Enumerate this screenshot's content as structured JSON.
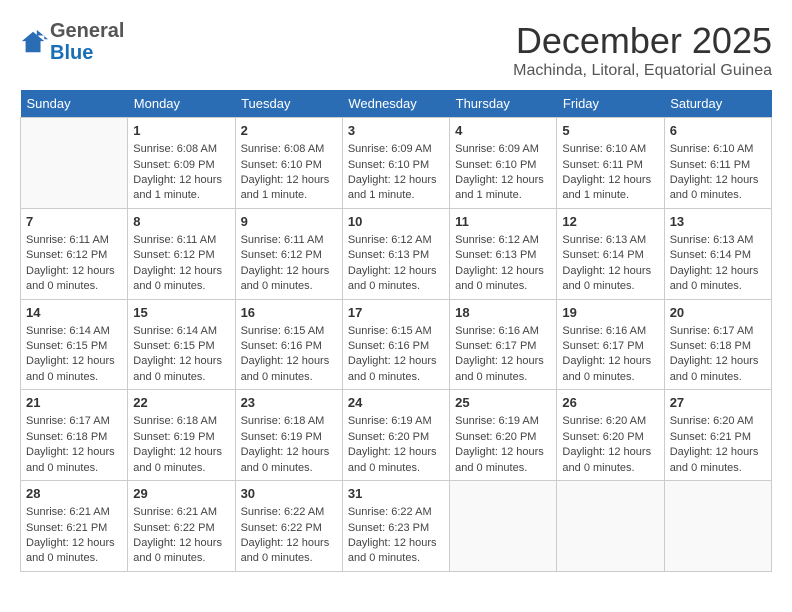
{
  "header": {
    "logo_line1": "General",
    "logo_line2": "Blue",
    "month_year": "December 2025",
    "location": "Machinda, Litoral, Equatorial Guinea"
  },
  "days_of_week": [
    "Sunday",
    "Monday",
    "Tuesday",
    "Wednesday",
    "Thursday",
    "Friday",
    "Saturday"
  ],
  "weeks": [
    [
      {
        "day": "",
        "content": ""
      },
      {
        "day": "1",
        "content": "Sunrise: 6:08 AM\nSunset: 6:09 PM\nDaylight: 12 hours and 1 minute."
      },
      {
        "day": "2",
        "content": "Sunrise: 6:08 AM\nSunset: 6:10 PM\nDaylight: 12 hours and 1 minute."
      },
      {
        "day": "3",
        "content": "Sunrise: 6:09 AM\nSunset: 6:10 PM\nDaylight: 12 hours and 1 minute."
      },
      {
        "day": "4",
        "content": "Sunrise: 6:09 AM\nSunset: 6:10 PM\nDaylight: 12 hours and 1 minute."
      },
      {
        "day": "5",
        "content": "Sunrise: 6:10 AM\nSunset: 6:11 PM\nDaylight: 12 hours and 1 minute."
      },
      {
        "day": "6",
        "content": "Sunrise: 6:10 AM\nSunset: 6:11 PM\nDaylight: 12 hours and 0 minutes."
      }
    ],
    [
      {
        "day": "7",
        "content": "Sunrise: 6:11 AM\nSunset: 6:12 PM\nDaylight: 12 hours and 0 minutes."
      },
      {
        "day": "8",
        "content": "Sunrise: 6:11 AM\nSunset: 6:12 PM\nDaylight: 12 hours and 0 minutes."
      },
      {
        "day": "9",
        "content": "Sunrise: 6:11 AM\nSunset: 6:12 PM\nDaylight: 12 hours and 0 minutes."
      },
      {
        "day": "10",
        "content": "Sunrise: 6:12 AM\nSunset: 6:13 PM\nDaylight: 12 hours and 0 minutes."
      },
      {
        "day": "11",
        "content": "Sunrise: 6:12 AM\nSunset: 6:13 PM\nDaylight: 12 hours and 0 minutes."
      },
      {
        "day": "12",
        "content": "Sunrise: 6:13 AM\nSunset: 6:14 PM\nDaylight: 12 hours and 0 minutes."
      },
      {
        "day": "13",
        "content": "Sunrise: 6:13 AM\nSunset: 6:14 PM\nDaylight: 12 hours and 0 minutes."
      }
    ],
    [
      {
        "day": "14",
        "content": "Sunrise: 6:14 AM\nSunset: 6:15 PM\nDaylight: 12 hours and 0 minutes."
      },
      {
        "day": "15",
        "content": "Sunrise: 6:14 AM\nSunset: 6:15 PM\nDaylight: 12 hours and 0 minutes."
      },
      {
        "day": "16",
        "content": "Sunrise: 6:15 AM\nSunset: 6:16 PM\nDaylight: 12 hours and 0 minutes."
      },
      {
        "day": "17",
        "content": "Sunrise: 6:15 AM\nSunset: 6:16 PM\nDaylight: 12 hours and 0 minutes."
      },
      {
        "day": "18",
        "content": "Sunrise: 6:16 AM\nSunset: 6:17 PM\nDaylight: 12 hours and 0 minutes."
      },
      {
        "day": "19",
        "content": "Sunrise: 6:16 AM\nSunset: 6:17 PM\nDaylight: 12 hours and 0 minutes."
      },
      {
        "day": "20",
        "content": "Sunrise: 6:17 AM\nSunset: 6:18 PM\nDaylight: 12 hours and 0 minutes."
      }
    ],
    [
      {
        "day": "21",
        "content": "Sunrise: 6:17 AM\nSunset: 6:18 PM\nDaylight: 12 hours and 0 minutes."
      },
      {
        "day": "22",
        "content": "Sunrise: 6:18 AM\nSunset: 6:19 PM\nDaylight: 12 hours and 0 minutes."
      },
      {
        "day": "23",
        "content": "Sunrise: 6:18 AM\nSunset: 6:19 PM\nDaylight: 12 hours and 0 minutes."
      },
      {
        "day": "24",
        "content": "Sunrise: 6:19 AM\nSunset: 6:20 PM\nDaylight: 12 hours and 0 minutes."
      },
      {
        "day": "25",
        "content": "Sunrise: 6:19 AM\nSunset: 6:20 PM\nDaylight: 12 hours and 0 minutes."
      },
      {
        "day": "26",
        "content": "Sunrise: 6:20 AM\nSunset: 6:20 PM\nDaylight: 12 hours and 0 minutes."
      },
      {
        "day": "27",
        "content": "Sunrise: 6:20 AM\nSunset: 6:21 PM\nDaylight: 12 hours and 0 minutes."
      }
    ],
    [
      {
        "day": "28",
        "content": "Sunrise: 6:21 AM\nSunset: 6:21 PM\nDaylight: 12 hours and 0 minutes."
      },
      {
        "day": "29",
        "content": "Sunrise: 6:21 AM\nSunset: 6:22 PM\nDaylight: 12 hours and 0 minutes."
      },
      {
        "day": "30",
        "content": "Sunrise: 6:22 AM\nSunset: 6:22 PM\nDaylight: 12 hours and 0 minutes."
      },
      {
        "day": "31",
        "content": "Sunrise: 6:22 AM\nSunset: 6:23 PM\nDaylight: 12 hours and 0 minutes."
      },
      {
        "day": "",
        "content": ""
      },
      {
        "day": "",
        "content": ""
      },
      {
        "day": "",
        "content": ""
      }
    ]
  ]
}
